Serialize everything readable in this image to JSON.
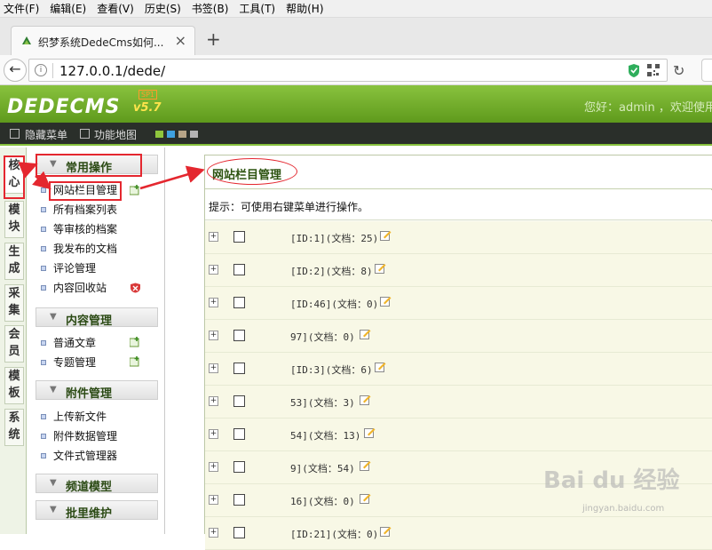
{
  "browser": {
    "menu": [
      "文件(F)",
      "编辑(E)",
      "查看(V)",
      "历史(S)",
      "书签(B)",
      "工具(T)",
      "帮助(H)"
    ],
    "tab_title": "织梦系统DedeCms如何...",
    "tab_close": "×",
    "new_tab": "+",
    "url": "127.0.0.1/dede/",
    "back": "←",
    "reload": "↻",
    "info": "i"
  },
  "header": {
    "logo": "DEDECMS",
    "version": "v5.7",
    "sp": "SP1",
    "welcome": "您好：admin ，欢迎使用D"
  },
  "toolbar": {
    "hide_menu": "隐藏菜单",
    "site_map": "功能地图",
    "swatches": [
      "#8fc63d",
      "#3fa1df",
      "#b7a587",
      "#b4b4b4"
    ]
  },
  "categories": [
    {
      "label": "核\n心"
    },
    {
      "label": "模\n块"
    },
    {
      "label": "生\n成"
    },
    {
      "label": "采\n集"
    },
    {
      "label": "会\n员"
    },
    {
      "label": "模\n板"
    },
    {
      "label": "系\n统"
    }
  ],
  "sidebar": {
    "groups": [
      {
        "title": "常用操作",
        "items": [
          "网站栏目管理",
          "所有档案列表",
          "等审核的档案",
          "我发布的文档",
          "评论管理",
          "内容回收站"
        ]
      },
      {
        "title": "内容管理",
        "items": [
          "普通文章",
          "专题管理"
        ]
      },
      {
        "title": "附件管理",
        "items": [
          "上传新文件",
          "附件数据管理",
          "文件式管理器"
        ]
      },
      {
        "title": "频道模型",
        "items": []
      },
      {
        "title": "批里维护",
        "items": []
      }
    ]
  },
  "main": {
    "title": "网站栏目管理",
    "tip": "提示：可使用右键菜单进行操作。",
    "rows": [
      "[ID:1](文档：25)",
      "[ID:2](文档：8)",
      "[ID:46](文档：0)",
      "97](文档：0)",
      "[ID:3](文档：6)",
      "53](文档：3)",
      "54](文档：13)",
      "9](文档：54)",
      "16](文档：0)",
      "[ID:21](文档：0)"
    ]
  },
  "watermark": {
    "brand": "Bai du 经验",
    "sub": "jingyan.baidu.com"
  }
}
